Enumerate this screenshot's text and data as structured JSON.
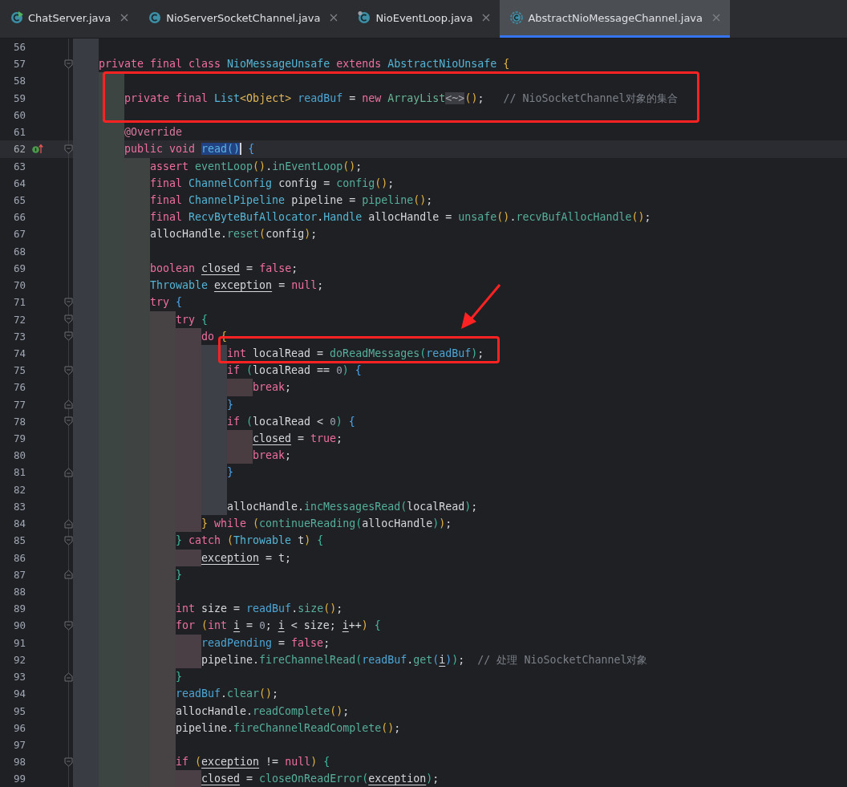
{
  "tabs": [
    {
      "label": "ChatServer.java",
      "kind": "runnable",
      "selected": false
    },
    {
      "label": "NioServerSocketChannel.java",
      "kind": "class",
      "selected": false
    },
    {
      "label": "NioEventLoop.java",
      "kind": "marked",
      "selected": false
    },
    {
      "label": "AbstractNioMessageChannel.java",
      "kind": "abstract",
      "selected": true
    }
  ],
  "editor": {
    "lines": [
      {
        "number": "56"
      },
      {
        "number": "57",
        "fold_start": true,
        "tokens": [
          {
            "text": "private final class ",
            "kind": "kw"
          },
          {
            "text": "NioMessageUnsafe ",
            "kind": "type"
          },
          {
            "text": "extends ",
            "kind": "kw"
          },
          {
            "text": "AbstractNioUnsafe ",
            "kind": "type"
          },
          {
            "text": "{",
            "kind": "p1"
          }
        ],
        "children": [
          {
            "number": "58"
          },
          {
            "number": "59",
            "tokens": [
              {
                "text": "private final ",
                "kind": "kw"
              },
              {
                "text": "List",
                "kind": "type"
              },
              {
                "text": "<Object> ",
                "kind": "gen"
              },
              {
                "text": "readBuf",
                "kind": "field"
              },
              {
                "text": " = ",
                "kind": "plain"
              },
              {
                "text": "new ",
                "kind": "kw"
              },
              {
                "text": "ArrayList",
                "kind": "ctor"
              },
              {
                "text": "<~>",
                "kind": "fold"
              },
              {
                "text": "()",
                "kind": "p1"
              },
              {
                "text": ";   ",
                "kind": "plain"
              },
              {
                "text": "// NioSocketChannel对象的集合",
                "kind": "comment"
              }
            ]
          },
          {
            "number": "60"
          },
          {
            "number": "61",
            "tokens": [
              {
                "text": "@Override",
                "kind": "anno"
              }
            ]
          },
          {
            "number": "62",
            "current": true,
            "fold_start": true,
            "overrides": true,
            "tokens": [
              {
                "text": "public void ",
                "kind": "kw"
              },
              {
                "text": "read()",
                "kind": "sel"
              },
              {
                "text": " {",
                "kind": "p3"
              }
            ],
            "children": [
              {
                "number": "63",
                "tokens": [
                  {
                    "text": "assert ",
                    "kind": "kw"
                  },
                  {
                    "text": "eventLoop",
                    "kind": "call"
                  },
                  {
                    "text": "()",
                    "kind": "p1"
                  },
                  {
                    "text": ".",
                    "kind": "plain"
                  },
                  {
                    "text": "inEventLoop",
                    "kind": "call"
                  },
                  {
                    "text": "()",
                    "kind": "p1"
                  },
                  {
                    "text": ";",
                    "kind": "plain"
                  }
                ]
              },
              {
                "number": "64",
                "tokens": [
                  {
                    "text": "final ",
                    "kind": "kw"
                  },
                  {
                    "text": "ChannelConfig",
                    "kind": "type"
                  },
                  {
                    "text": " config = ",
                    "kind": "plain"
                  },
                  {
                    "text": "config",
                    "kind": "call"
                  },
                  {
                    "text": "()",
                    "kind": "p1"
                  },
                  {
                    "text": ";",
                    "kind": "plain"
                  }
                ]
              },
              {
                "number": "65",
                "tokens": [
                  {
                    "text": "final ",
                    "kind": "kw"
                  },
                  {
                    "text": "ChannelPipeline",
                    "kind": "type"
                  },
                  {
                    "text": " pipeline = ",
                    "kind": "plain"
                  },
                  {
                    "text": "pipeline",
                    "kind": "call"
                  },
                  {
                    "text": "()",
                    "kind": "p1"
                  },
                  {
                    "text": ";",
                    "kind": "plain"
                  }
                ]
              },
              {
                "number": "66",
                "tokens": [
                  {
                    "text": "final ",
                    "kind": "kw"
                  },
                  {
                    "text": "RecvByteBufAllocator",
                    "kind": "type"
                  },
                  {
                    "text": ".",
                    "kind": "plain"
                  },
                  {
                    "text": "Handle",
                    "kind": "type"
                  },
                  {
                    "text": " allocHandle = ",
                    "kind": "plain"
                  },
                  {
                    "text": "unsafe",
                    "kind": "call"
                  },
                  {
                    "text": "()",
                    "kind": "p1"
                  },
                  {
                    "text": ".",
                    "kind": "plain"
                  },
                  {
                    "text": "recvBufAllocHandle",
                    "kind": "call"
                  },
                  {
                    "text": "()",
                    "kind": "p1"
                  },
                  {
                    "text": ";",
                    "kind": "plain"
                  }
                ]
              },
              {
                "number": "67",
                "tokens": [
                  {
                    "text": "allocHandle.",
                    "kind": "plain"
                  },
                  {
                    "text": "reset",
                    "kind": "call"
                  },
                  {
                    "text": "(",
                    "kind": "p1"
                  },
                  {
                    "text": "config",
                    "kind": "plain"
                  },
                  {
                    "text": ")",
                    "kind": "p1"
                  },
                  {
                    "text": ";",
                    "kind": "plain"
                  }
                ]
              },
              {
                "number": "68"
              },
              {
                "number": "69",
                "tokens": [
                  {
                    "text": "boolean ",
                    "kind": "kw"
                  },
                  {
                    "text": "closed",
                    "kind": "var"
                  },
                  {
                    "text": " = ",
                    "kind": "plain"
                  },
                  {
                    "text": "false",
                    "kind": "kw"
                  },
                  {
                    "text": ";",
                    "kind": "plain"
                  }
                ]
              },
              {
                "number": "70",
                "tokens": [
                  {
                    "text": "Throwable ",
                    "kind": "type"
                  },
                  {
                    "text": "exception",
                    "kind": "var"
                  },
                  {
                    "text": " = ",
                    "kind": "plain"
                  },
                  {
                    "text": "null",
                    "kind": "kw"
                  },
                  {
                    "text": ";",
                    "kind": "plain"
                  }
                ]
              },
              {
                "number": "71",
                "fold_start": true,
                "tokens": [
                  {
                    "text": "try ",
                    "kind": "kw"
                  },
                  {
                    "text": "{",
                    "kind": "p3"
                  }
                ],
                "children": [
                  {
                    "number": "72",
                    "fold_start": true,
                    "tokens": [
                      {
                        "text": "try ",
                        "kind": "kw"
                      },
                      {
                        "text": "{",
                        "kind": "p2"
                      }
                    ],
                    "children": [
                      {
                        "number": "73",
                        "fold_start": true,
                        "tokens": [
                          {
                            "text": "do ",
                            "kind": "kw"
                          },
                          {
                            "text": "{",
                            "kind": "p1"
                          }
                        ],
                        "children": [
                          {
                            "number": "74",
                            "tokens": [
                              {
                                "text": "int ",
                                "kind": "kw"
                              },
                              {
                                "text": "localRead = ",
                                "kind": "plain"
                              },
                              {
                                "text": "doReadMessages",
                                "kind": "call"
                              },
                              {
                                "text": "(",
                                "kind": "p2"
                              },
                              {
                                "text": "readBuf",
                                "kind": "field"
                              },
                              {
                                "text": ")",
                                "kind": "p2"
                              },
                              {
                                "text": ";",
                                "kind": "plain"
                              }
                            ]
                          },
                          {
                            "number": "75",
                            "fold_start": true,
                            "tokens": [
                              {
                                "text": "if ",
                                "kind": "kw"
                              },
                              {
                                "text": "(",
                                "kind": "p2"
                              },
                              {
                                "text": "localRead == ",
                                "kind": "plain"
                              },
                              {
                                "text": "0",
                                "kind": "num"
                              },
                              {
                                "text": ")",
                                "kind": "p2"
                              },
                              {
                                "text": " {",
                                "kind": "p3"
                              }
                            ],
                            "children": [
                              {
                                "number": "76",
                                "tokens": [
                                  {
                                    "text": "break",
                                    "kind": "kw"
                                  },
                                  {
                                    "text": ";",
                                    "kind": "plain"
                                  }
                                ]
                              }
                            ]
                          },
                          {
                            "number": "77",
                            "fold_end": true,
                            "tokens": [
                              {
                                "text": "}",
                                "kind": "p3"
                              }
                            ]
                          },
                          {
                            "number": "78",
                            "fold_start": true,
                            "tokens": [
                              {
                                "text": "if ",
                                "kind": "kw"
                              },
                              {
                                "text": "(",
                                "kind": "p2"
                              },
                              {
                                "text": "localRead < ",
                                "kind": "plain"
                              },
                              {
                                "text": "0",
                                "kind": "num"
                              },
                              {
                                "text": ")",
                                "kind": "p2"
                              },
                              {
                                "text": " {",
                                "kind": "p3"
                              }
                            ],
                            "children": [
                              {
                                "number": "79",
                                "tokens": [
                                  {
                                    "text": "closed",
                                    "kind": "var"
                                  },
                                  {
                                    "text": " = ",
                                    "kind": "plain"
                                  },
                                  {
                                    "text": "true",
                                    "kind": "kw"
                                  },
                                  {
                                    "text": ";",
                                    "kind": "plain"
                                  }
                                ]
                              },
                              {
                                "number": "80",
                                "tokens": [
                                  {
                                    "text": "break",
                                    "kind": "kw"
                                  },
                                  {
                                    "text": ";",
                                    "kind": "plain"
                                  }
                                ]
                              }
                            ]
                          },
                          {
                            "number": "81",
                            "fold_end": true,
                            "tokens": [
                              {
                                "text": "}",
                                "kind": "p3"
                              }
                            ]
                          },
                          {
                            "number": "82"
                          },
                          {
                            "number": "83",
                            "tokens": [
                              {
                                "text": "allocHandle.",
                                "kind": "plain"
                              },
                              {
                                "text": "incMessagesRead",
                                "kind": "call"
                              },
                              {
                                "text": "(",
                                "kind": "p2"
                              },
                              {
                                "text": "localRead",
                                "kind": "plain"
                              },
                              {
                                "text": ")",
                                "kind": "p2"
                              },
                              {
                                "text": ";",
                                "kind": "plain"
                              }
                            ]
                          }
                        ]
                      },
                      {
                        "number": "84",
                        "fold_end": true,
                        "tokens": [
                          {
                            "text": "} ",
                            "kind": "p1"
                          },
                          {
                            "text": "while ",
                            "kind": "kw"
                          },
                          {
                            "text": "(",
                            "kind": "p1"
                          },
                          {
                            "text": "continueReading",
                            "kind": "call"
                          },
                          {
                            "text": "(",
                            "kind": "p2"
                          },
                          {
                            "text": "allocHandle",
                            "kind": "plain"
                          },
                          {
                            "text": ")",
                            "kind": "p2"
                          },
                          {
                            "text": ")",
                            "kind": "p1"
                          },
                          {
                            "text": ";",
                            "kind": "plain"
                          }
                        ]
                      }
                    ]
                  },
                  {
                    "number": "85",
                    "fold_start": true,
                    "tokens": [
                      {
                        "text": "} ",
                        "kind": "p2"
                      },
                      {
                        "text": "catch ",
                        "kind": "kw"
                      },
                      {
                        "text": "(",
                        "kind": "p1"
                      },
                      {
                        "text": "Throwable",
                        "kind": "type"
                      },
                      {
                        "text": " t",
                        "kind": "plain"
                      },
                      {
                        "text": ")",
                        "kind": "p1"
                      },
                      {
                        "text": " {",
                        "kind": "p2"
                      }
                    ],
                    "children": [
                      {
                        "number": "86",
                        "tokens": [
                          {
                            "text": "exception",
                            "kind": "var"
                          },
                          {
                            "text": " = t;",
                            "kind": "plain"
                          }
                        ]
                      }
                    ]
                  },
                  {
                    "number": "87",
                    "fold_end": true,
                    "tokens": [
                      {
                        "text": "}",
                        "kind": "p2"
                      }
                    ]
                  },
                  {
                    "number": "88"
                  },
                  {
                    "number": "89",
                    "tokens": [
                      {
                        "text": "int ",
                        "kind": "kw"
                      },
                      {
                        "text": "size = ",
                        "kind": "plain"
                      },
                      {
                        "text": "readBuf",
                        "kind": "field"
                      },
                      {
                        "text": ".",
                        "kind": "plain"
                      },
                      {
                        "text": "size",
                        "kind": "call"
                      },
                      {
                        "text": "()",
                        "kind": "p1"
                      },
                      {
                        "text": ";",
                        "kind": "plain"
                      }
                    ]
                  },
                  {
                    "number": "90",
                    "fold_start": true,
                    "tokens": [
                      {
                        "text": "for ",
                        "kind": "kw"
                      },
                      {
                        "text": "(",
                        "kind": "p1"
                      },
                      {
                        "text": "int ",
                        "kind": "kw"
                      },
                      {
                        "text": "i",
                        "kind": "var"
                      },
                      {
                        "text": " = ",
                        "kind": "plain"
                      },
                      {
                        "text": "0",
                        "kind": "num"
                      },
                      {
                        "text": "; ",
                        "kind": "plain"
                      },
                      {
                        "text": "i",
                        "kind": "var"
                      },
                      {
                        "text": " < size; ",
                        "kind": "plain"
                      },
                      {
                        "text": "i",
                        "kind": "var"
                      },
                      {
                        "text": "++",
                        "kind": "plain"
                      },
                      {
                        "text": ")",
                        "kind": "p1"
                      },
                      {
                        "text": " {",
                        "kind": "p2"
                      }
                    ],
                    "children": [
                      {
                        "number": "91",
                        "tokens": [
                          {
                            "text": "readPending",
                            "kind": "field"
                          },
                          {
                            "text": " = ",
                            "kind": "plain"
                          },
                          {
                            "text": "false",
                            "kind": "kw"
                          },
                          {
                            "text": ";",
                            "kind": "plain"
                          }
                        ]
                      },
                      {
                        "number": "92",
                        "tokens": [
                          {
                            "text": "pipeline.",
                            "kind": "plain"
                          },
                          {
                            "text": "fireChannelRead",
                            "kind": "call"
                          },
                          {
                            "text": "(",
                            "kind": "p2"
                          },
                          {
                            "text": "readBuf",
                            "kind": "field"
                          },
                          {
                            "text": ".",
                            "kind": "plain"
                          },
                          {
                            "text": "get",
                            "kind": "call"
                          },
                          {
                            "text": "(",
                            "kind": "p3"
                          },
                          {
                            "text": "i",
                            "kind": "var"
                          },
                          {
                            "text": ")",
                            "kind": "p3"
                          },
                          {
                            "text": ")",
                            "kind": "p2"
                          },
                          {
                            "text": ";  ",
                            "kind": "plain"
                          },
                          {
                            "text": "// 处理 NioSocketChannel对象",
                            "kind": "comment"
                          }
                        ]
                      }
                    ]
                  },
                  {
                    "number": "93",
                    "fold_end": true,
                    "tokens": [
                      {
                        "text": "}",
                        "kind": "p2"
                      }
                    ]
                  },
                  {
                    "number": "94",
                    "tokens": [
                      {
                        "text": "readBuf",
                        "kind": "field"
                      },
                      {
                        "text": ".",
                        "kind": "plain"
                      },
                      {
                        "text": "clear",
                        "kind": "call"
                      },
                      {
                        "text": "()",
                        "kind": "p1"
                      },
                      {
                        "text": ";",
                        "kind": "plain"
                      }
                    ]
                  },
                  {
                    "number": "95",
                    "tokens": [
                      {
                        "text": "allocHandle.",
                        "kind": "plain"
                      },
                      {
                        "text": "readComplete",
                        "kind": "call"
                      },
                      {
                        "text": "()",
                        "kind": "p1"
                      },
                      {
                        "text": ";",
                        "kind": "plain"
                      }
                    ]
                  },
                  {
                    "number": "96",
                    "tokens": [
                      {
                        "text": "pipeline.",
                        "kind": "plain"
                      },
                      {
                        "text": "fireChannelReadComplete",
                        "kind": "call"
                      },
                      {
                        "text": "()",
                        "kind": "p1"
                      },
                      {
                        "text": ";",
                        "kind": "plain"
                      }
                    ]
                  },
                  {
                    "number": "97"
                  },
                  {
                    "number": "98",
                    "fold_start": true,
                    "tokens": [
                      {
                        "text": "if ",
                        "kind": "kw"
                      },
                      {
                        "text": "(",
                        "kind": "p1"
                      },
                      {
                        "text": "exception",
                        "kind": "var"
                      },
                      {
                        "text": " != ",
                        "kind": "plain"
                      },
                      {
                        "text": "null",
                        "kind": "kw"
                      },
                      {
                        "text": ")",
                        "kind": "p1"
                      },
                      {
                        "text": " {",
                        "kind": "p2"
                      }
                    ],
                    "children": [
                      {
                        "number": "99",
                        "tokens": [
                          {
                            "text": "closed",
                            "kind": "var"
                          },
                          {
                            "text": " = ",
                            "kind": "plain"
                          },
                          {
                            "text": "closeOnReadError",
                            "kind": "call"
                          },
                          {
                            "text": "(",
                            "kind": "p2"
                          },
                          {
                            "text": "exception",
                            "kind": "var"
                          },
                          {
                            "text": ")",
                            "kind": "p2"
                          },
                          {
                            "text": ";",
                            "kind": "plain"
                          }
                        ]
                      }
                    ]
                  }
                ]
              }
            ]
          }
        ]
      }
    ]
  }
}
